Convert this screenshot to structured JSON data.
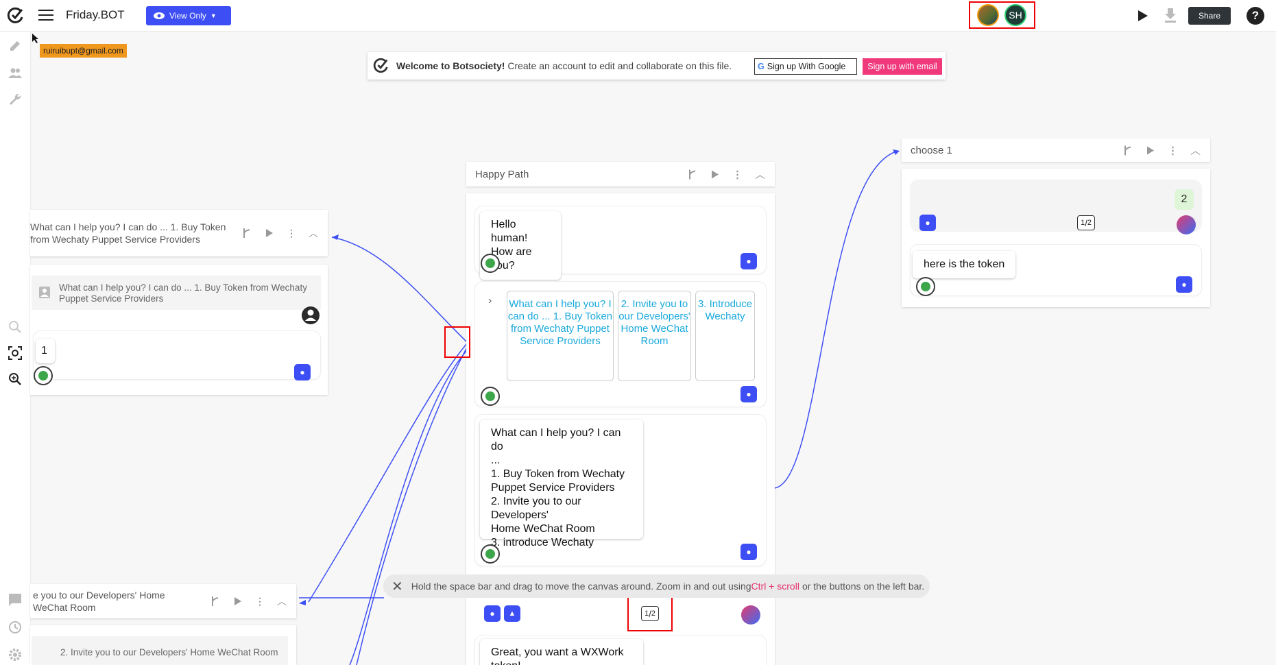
{
  "app": {
    "title": "Friday.BOT",
    "view_mode": "View Only",
    "share_label": "Share",
    "help_label": "?",
    "avatars": [
      {
        "initials": ""
      },
      {
        "initials": "SH"
      }
    ]
  },
  "tooltip_email": "ruiruibupt@gmail.com",
  "welcome": {
    "brand": "Welcome to Botsociety!",
    "message": " Create an account to edit and collaborate on this file.",
    "google_label": "Sign up With Google",
    "email_label": "Sign up with email"
  },
  "happy_path": {
    "title": "Happy Path",
    "bubble1": [
      "Hello human!",
      "How are you?"
    ],
    "quick_replies": [
      "What can I help you? I can do ... 1. Buy Token from Wechaty Puppet Service Providers",
      "2. Invite you to our Developers' Home WeChat Room",
      "3. Introduce Wechaty"
    ],
    "menu_lines": [
      "What can I help you? I can do",
      "...",
      "1. Buy Token from Wechaty",
      "Puppet Service Providers",
      "2. Invite you to our Developers'",
      "Home WeChat Room",
      "3. introduce Wechaty"
    ],
    "pager_num": "1",
    "pager_den": "2",
    "bubble_bottom": "Great, you want a WXWork",
    "bubble_bottom_2": "token!"
  },
  "left_panel": {
    "title": "What can I help you? I can do ... 1. Buy Token from Wechaty Puppet Service Providers",
    "intent": "What can I help you? I can do ... 1. Buy Token from Wechaty Puppet Service Providers",
    "reply": "1"
  },
  "left_panel_2": {
    "title": "e you to our Developers' Home WeChat Room",
    "intent": "2. Invite you to our Developers' Home WeChat Room"
  },
  "choose_panel": {
    "title": "choose 1",
    "reply": "2",
    "pager_num": "1",
    "pager_den": "2",
    "bot_text": "here is the token"
  },
  "hint": {
    "before": "Hold the space bar and drag to move the canvas around. Zoom in and out using ",
    "keys": "Ctrl + scroll",
    "after": " or the buttons on the left bar."
  },
  "colors": {
    "accent": "#3d4ff4",
    "pink": "#f0397b",
    "link_line": "#3d4ff4",
    "quick_reply_text": "#17a8dc",
    "highlight": "#e00000"
  }
}
